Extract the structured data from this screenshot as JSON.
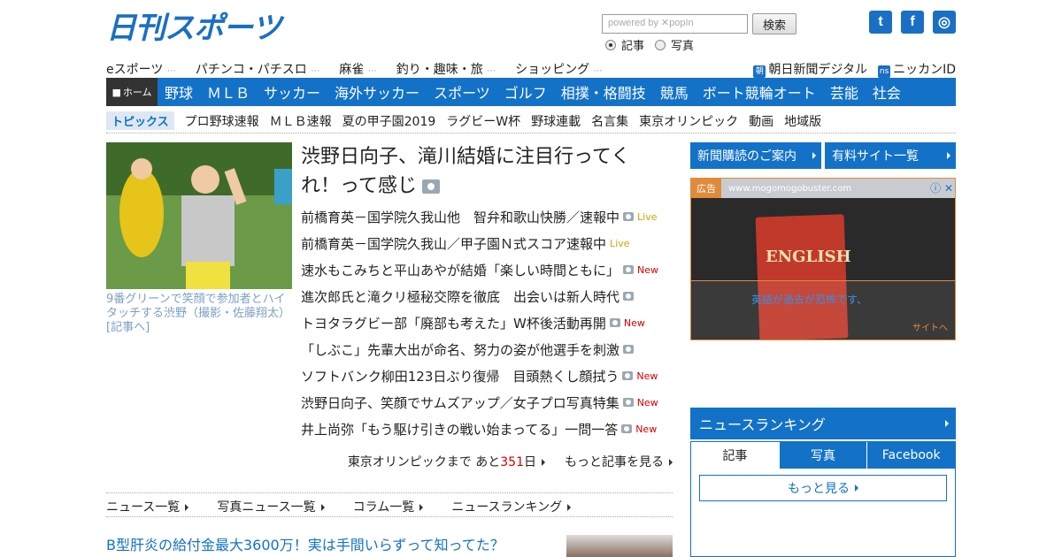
{
  "header": {
    "logo": "日刊スポーツ",
    "search_placeholder": "powered by ✕popIn",
    "search_button": "検索",
    "radio_articles": "記事",
    "radio_photos": "写真",
    "social": {
      "twitter": "t",
      "facebook": "f",
      "instagram": "◎"
    }
  },
  "util_links": [
    "eスポーツ",
    "パチンコ・パチスロ",
    "麻雀",
    "釣り・趣味・旅",
    "ショッピング"
  ],
  "util_right": [
    {
      "badge": "朝",
      "label": "朝日新聞デジタル"
    },
    {
      "badge": "ns",
      "label": "ニッカンID"
    }
  ],
  "nav": {
    "home": "ホーム",
    "items": [
      "野球",
      "ＭＬＢ",
      "サッカー",
      "海外サッカー",
      "スポーツ",
      "ゴルフ",
      "相撲・格闘技",
      "競馬",
      "ボート競輪オート",
      "芸能",
      "社会"
    ]
  },
  "topics": {
    "tag": "トピックス",
    "items": [
      "プロ野球速報",
      "ＭＬＢ速報",
      "夏の甲子園2019",
      "ラグビーW杯",
      "野球連載",
      "名言集",
      "東京オリンピック",
      "動画",
      "地域版"
    ]
  },
  "feature": {
    "headline": "渋野日向子、滝川結婚に注目行ってくれ！って感じ",
    "caption": "9番グリーンで笑顔で参加者とハイタッチする渋野（撮影・佐藤翔太） [記事へ]"
  },
  "news": [
    {
      "title": "前橋育英－国学院久我山他　智弁和歌山快勝／速報中",
      "camera": true,
      "label": "Live"
    },
    {
      "title": "前橋育英－国学院久我山／甲子園Ｎ式スコア速報中",
      "camera": false,
      "label": "Live"
    },
    {
      "title": "速水もこみちと平山あやが結婚「楽しい時間ともに」",
      "camera": true,
      "label": "New"
    },
    {
      "title": "進次郎氏と滝クリ極秘交際を徹底　出会いは新人時代",
      "camera": true,
      "label": ""
    },
    {
      "title": "トヨタラグビー部「廃部も考えた」W杯後活動再開",
      "camera": true,
      "label": "New"
    },
    {
      "title": "「しぶこ」先輩大出が命名、努力の姿が他選手を刺激",
      "camera": true,
      "label": ""
    },
    {
      "title": "ソフトバンク柳田123日ぶり復帰　目頭熱くし顔拭う",
      "camera": true,
      "label": "New"
    },
    {
      "title": "渋野日向子、笑顔でサムズアップ／女子プロ写真特集",
      "camera": true,
      "label": "New"
    },
    {
      "title": "井上尚弥「もう駆け引きの戦い始まってる」一問一答",
      "camera": true,
      "label": "New"
    }
  ],
  "countdown": {
    "prefix": "東京オリンピックまで あと",
    "days": "351",
    "suffix": "日"
  },
  "more_articles": "もっと記事を見る",
  "sub_links": [
    "ニュース一覧",
    "写真ニュース一覧",
    "コラム一覧",
    "ニュースランキング"
  ],
  "promo": "B型肝炎の給付金最大3600万！実は手間いらずって知ってた？",
  "side": {
    "btn_subscribe": "新聞購読のご案内",
    "btn_paid": "有料サイト一覧",
    "ad_tag": "広告",
    "ad_url": "www.mogomogobuster.com",
    "ad_book": "ENGLISH",
    "ad_copy": "英語が過去が恐怖です、",
    "ad_site": "サイトへ",
    "ranking_title": "ニュースランキング",
    "tabs": [
      "記事",
      "写真",
      "Facebook"
    ],
    "more": "もっと見る"
  },
  "colors": {
    "brand": "#1372c7",
    "live": "#d8a000",
    "new": "#d40000"
  }
}
